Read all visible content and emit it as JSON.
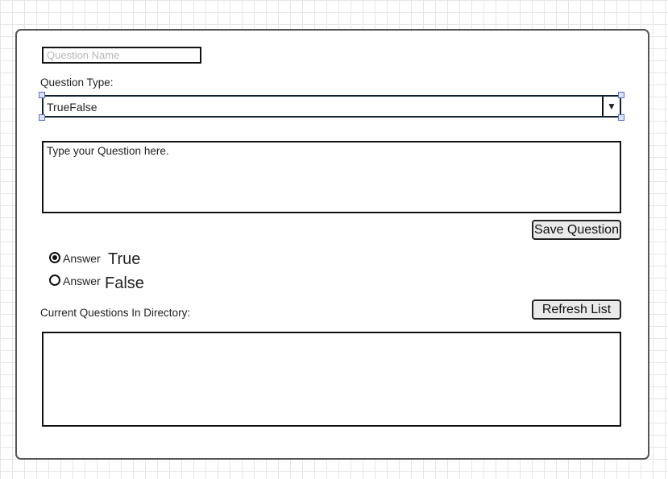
{
  "form": {
    "question_name": {
      "value": "",
      "placeholder": "Question Name"
    },
    "question_type_label": "Question Type:",
    "question_type_value": "TrueFalse",
    "question_type_arrow": "▼",
    "question_text": {
      "value": "",
      "placeholder": "Type your Question here."
    },
    "save_button": "Save Question",
    "answers": [
      {
        "prefix": "Answer",
        "value": "True",
        "selected": true
      },
      {
        "prefix": "Answer",
        "value": "False",
        "selected": false
      }
    ],
    "directory_label": "Current Questions In Directory:",
    "refresh_button": "Refresh List",
    "directory_items": []
  }
}
